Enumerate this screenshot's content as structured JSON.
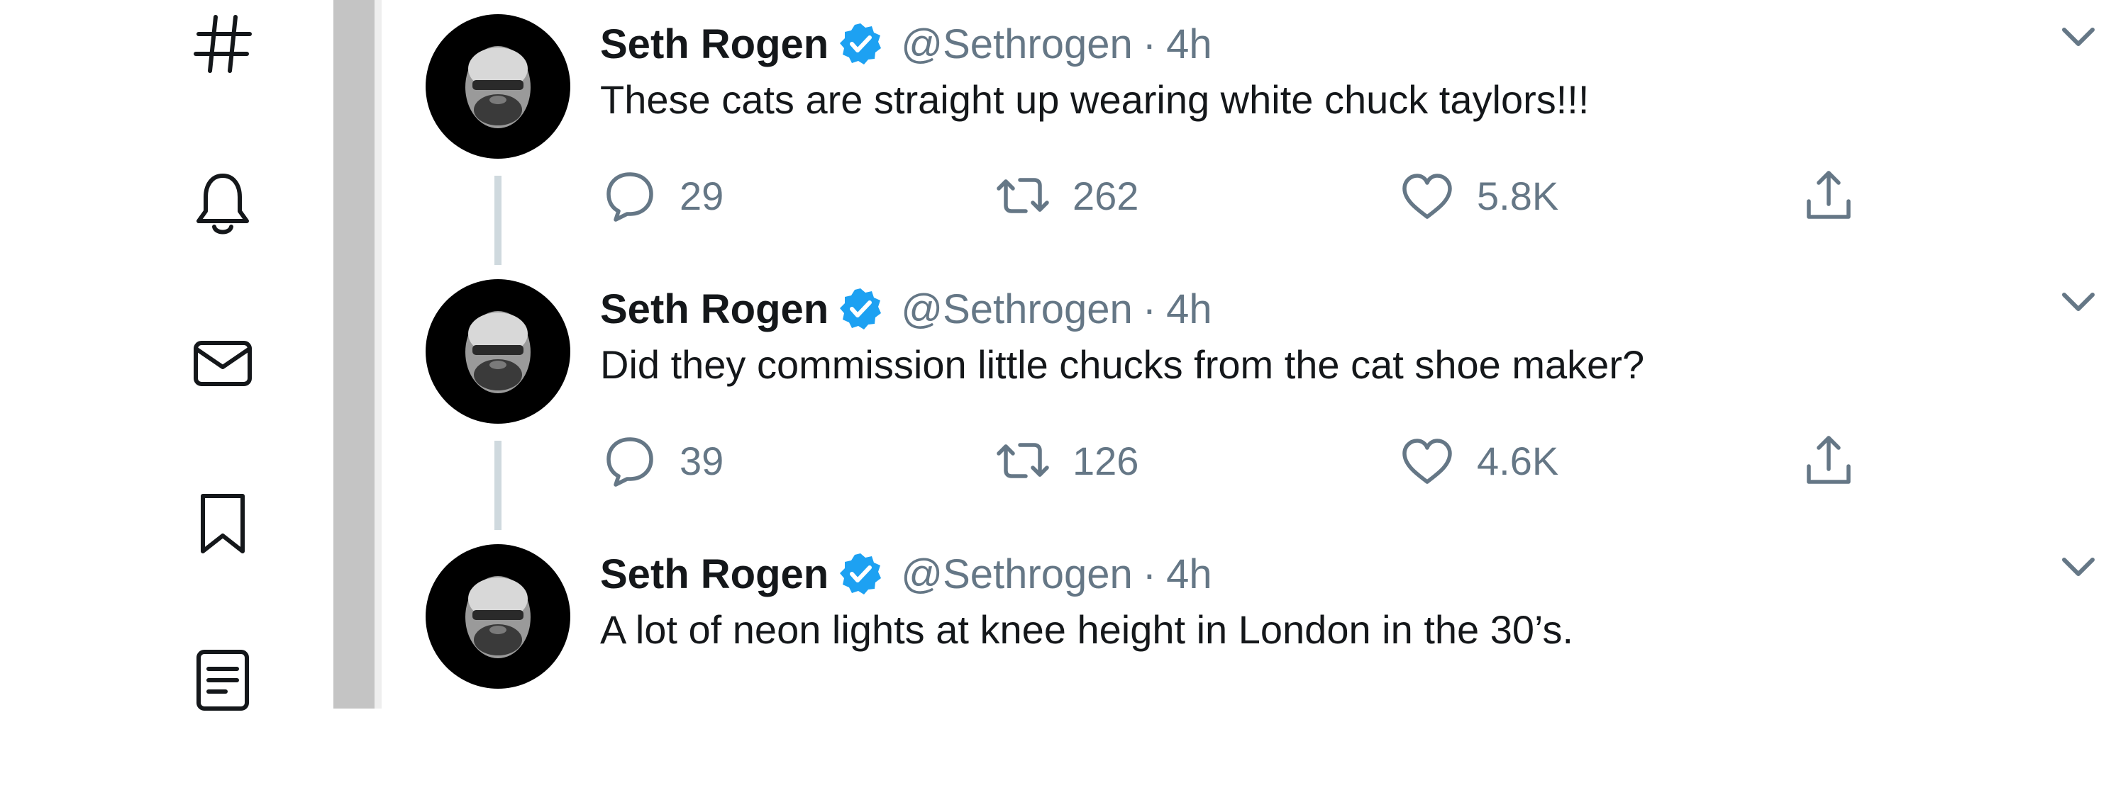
{
  "nav": {
    "icons": [
      "hashtag-icon",
      "bell-icon",
      "envelope-icon",
      "bookmark-icon",
      "list-icon"
    ]
  },
  "colors": {
    "text": "#14171a",
    "secondary": "#657786",
    "verified": "#1da1f2",
    "thread_line": "#cfd9de",
    "gutter": "#c4c4c4"
  },
  "tweets": [
    {
      "name": "Seth Rogen",
      "handle": "@Sethrogen",
      "separator": "·",
      "time": "4h",
      "text": "These cats are straight up wearing white chuck taylors!!!",
      "replies": "29",
      "retweets": "262",
      "likes": "5.8K"
    },
    {
      "name": "Seth Rogen",
      "handle": "@Sethrogen",
      "separator": "·",
      "time": "4h",
      "text": "Did they commission little chucks from the cat shoe maker?",
      "replies": "39",
      "retweets": "126",
      "likes": "4.6K"
    },
    {
      "name": "Seth Rogen",
      "handle": "@Sethrogen",
      "separator": "·",
      "time": "4h",
      "text": "A lot of neon lights at knee height in London in the 30’s."
    }
  ]
}
